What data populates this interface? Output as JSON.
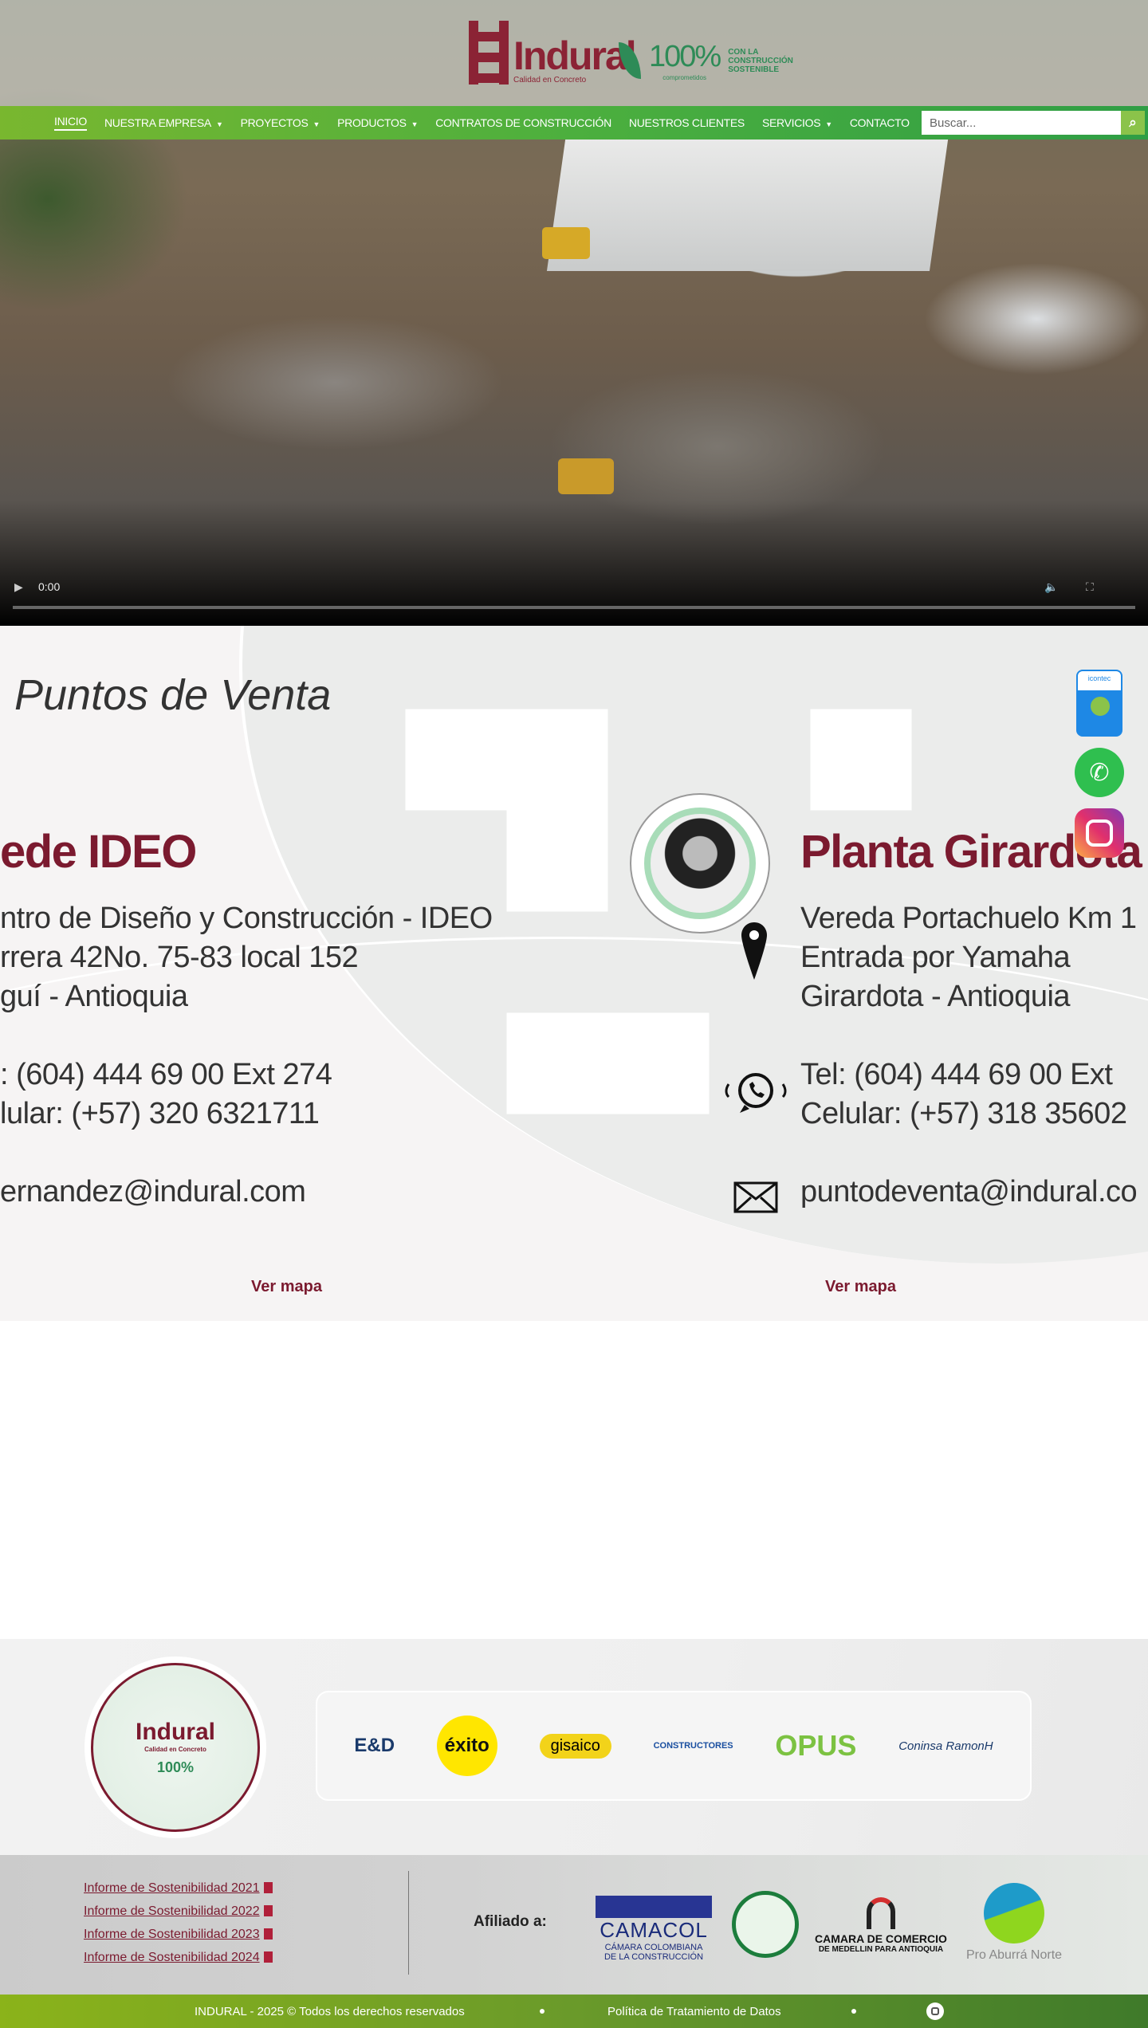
{
  "header": {
    "logo": {
      "name": "Indural",
      "tagline": "Calidad en Concreto"
    },
    "badge": {
      "percent": "100%",
      "sub": "comprometidos",
      "text": [
        "CON LA",
        "CONSTRUCCIÓN",
        "SOSTENIBLE"
      ]
    },
    "nav": [
      {
        "label": "INICIO",
        "active": true
      },
      {
        "label": "NUESTRA EMPRESA",
        "dropdown": true
      },
      {
        "label": "PROYECTOS",
        "dropdown": true
      },
      {
        "label": "PRODUCTOS",
        "dropdown": true
      },
      {
        "label": "CONTRATOS DE CONSTRUCCIÓN"
      },
      {
        "label": "NUESTROS CLIENTES"
      },
      {
        "label": "SERVICIOS",
        "dropdown": true
      },
      {
        "label": "CONTACTO"
      }
    ],
    "search": {
      "placeholder": "Buscar..."
    }
  },
  "video": {
    "time": "0:00",
    "progress": 0
  },
  "puntos": {
    "title": "Puntos de Venta",
    "left": {
      "heading": "ede IDEO",
      "address": [
        "ntro de Diseño y Construcción - IDEO",
        "rrera 42No. 75-83 local 152",
        "guí - Antioquia"
      ],
      "phones": [
        ": (604) 444 69 00 Ext 274",
        "lular: (+57) 320 6321711"
      ],
      "email": "ernandez@indural.com",
      "map": "Ver mapa"
    },
    "right": {
      "heading": "Planta Girardota",
      "address": [
        "Vereda Portachuelo Km 1",
        "Entrada por Yamaha",
        "Girardota - Antioquia"
      ],
      "phones": [
        "Tel: (604) 444 69 00 Ext",
        "Celular: (+57) 318 35602"
      ],
      "email": "puntodeventa@indural.co",
      "map": "Ver mapa"
    }
  },
  "floating": {
    "icontec": "icontec"
  },
  "clients": [
    "E&D",
    "éxito",
    "gisaico",
    "CONSTRUCTORES",
    "OPUS",
    "Coninsa RamonH"
  ],
  "footer": {
    "reports": [
      "Informe de Sostenibilidad 2021",
      "Informe de Sostenibilidad 2022",
      "Informe de Sostenibilidad 2023",
      "Informe de Sostenibilidad 2024"
    ],
    "affiliated_label": "Afiliado a:",
    "camacol": {
      "name": "CAMACOL",
      "sub1": "CÁMARA COLOMBIANA",
      "sub2": "DE LA CONSTRUCCIÓN"
    },
    "ccma": {
      "line1": "CAMARA DE COMERCIO",
      "line2": "DE MEDELLIN PARA ANTIOQUIA"
    },
    "proaburra": "Pro Aburrá Norte",
    "copyright": "INDURAL - 2025 © Todos los derechos reservados",
    "privacy": "Política de Tratamiento de Datos"
  },
  "colors": {
    "brand": "#7b1a2f",
    "nav_green": "#4caf3e",
    "search_btn": "#8bc34a"
  }
}
